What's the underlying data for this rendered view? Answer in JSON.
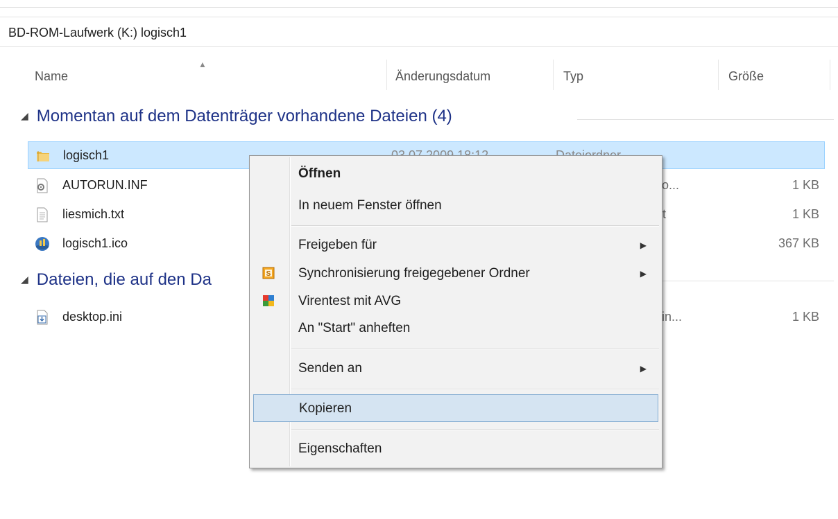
{
  "path": "BD-ROM-Laufwerk (K:) logisch1",
  "columns": {
    "name": "Name",
    "date": "Änderungsdatum",
    "type": "Typ",
    "size": "Größe"
  },
  "groups": [
    {
      "label": "Momentan auf dem Datenträger vorhandene Dateien (4)"
    },
    {
      "label": "Dateien, die auf den Da"
    }
  ],
  "files": [
    {
      "name": "logisch1",
      "date": "03.07.2009 18:12",
      "type": "Dateiordner",
      "size": "",
      "icon": "folder-icon"
    },
    {
      "name": "AUTORUN.INF",
      "date": "",
      "type": "atio...",
      "size": "1 KB",
      "icon": "settings-file-icon"
    },
    {
      "name": "liesmich.txt",
      "date": "",
      "type": "t",
      "size": "1 KB",
      "icon": "text-file-icon"
    },
    {
      "name": "logisch1.ico",
      "date": "",
      "type": "",
      "size": "367 KB",
      "icon": "image-icon"
    },
    {
      "name": "desktop.ini",
      "date": "",
      "type": "sein...",
      "size": "1 KB",
      "icon": "pending-file-icon"
    }
  ],
  "context_menu": {
    "open": "Öffnen",
    "open_new_window": "In neuem Fenster öffnen",
    "share_with": "Freigeben für",
    "sync_shared": "Synchronisierung freigegebener Ordner",
    "virus_scan": "Virentest mit AVG",
    "pin_start": "An \"Start\" anheften",
    "send_to": "Senden an",
    "copy": "Kopieren",
    "properties": "Eigenschaften",
    "submenu_arrow": "▶"
  },
  "colors": {
    "selection": "#cce8ff",
    "group_heading": "#1e3287",
    "menu_highlight": "#d5e4f2"
  }
}
